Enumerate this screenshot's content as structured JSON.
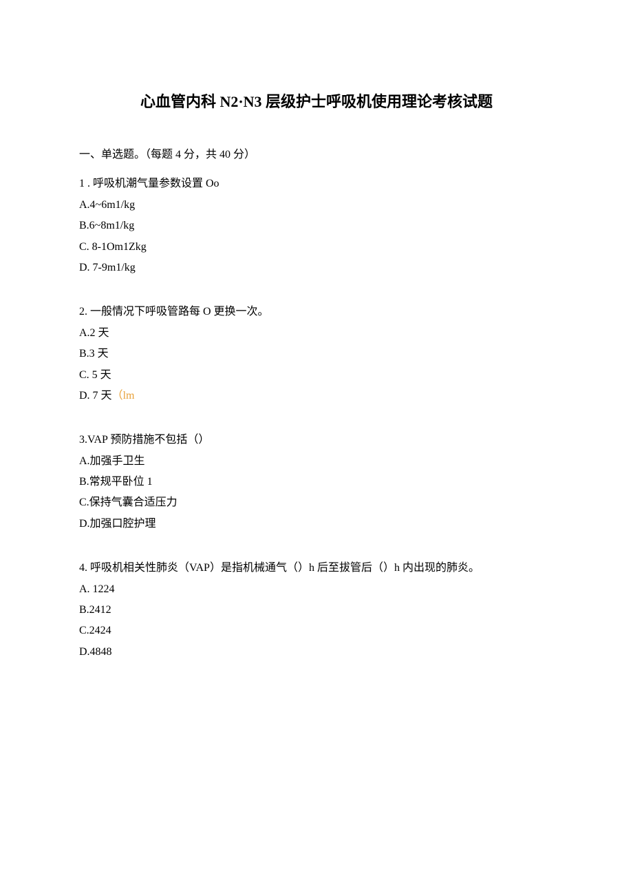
{
  "title": "心血管内科 N2·N3 层级护士呼吸机使用理论考核试题",
  "sectionHeader": "一、单选题。（每题 4 分，共 40 分）",
  "questions": [
    {
      "text": "1 . 呼吸机潮气量参数设置 Oo",
      "options": [
        "A.4~6m1/kg",
        "B.6~8m1/kg",
        "C.   8-1Om1Zkg",
        "D.   7-9m1/kg"
      ]
    },
    {
      "text": "2. 一般情况下呼吸管路每 O 更换一次。",
      "options": [
        "A.2 天",
        "B.3 天",
        "C.   5 天",
        "D.   7 天"
      ],
      "suffix": "（lm"
    },
    {
      "text": "3.VAP 预防措施不包括（）",
      "options": [
        "A.加强手卫生",
        "B.常规平卧位 1",
        "C.保持气囊合适压力",
        "D.加强口腔护理"
      ]
    },
    {
      "text": "4. 呼吸机相关性肺炎（VAP）是指机械通气（）h 后至拔管后（）h 内出现的肺炎。",
      "options": [
        "A.   1224",
        "B.2412",
        "C.2424",
        "D.4848"
      ]
    }
  ]
}
